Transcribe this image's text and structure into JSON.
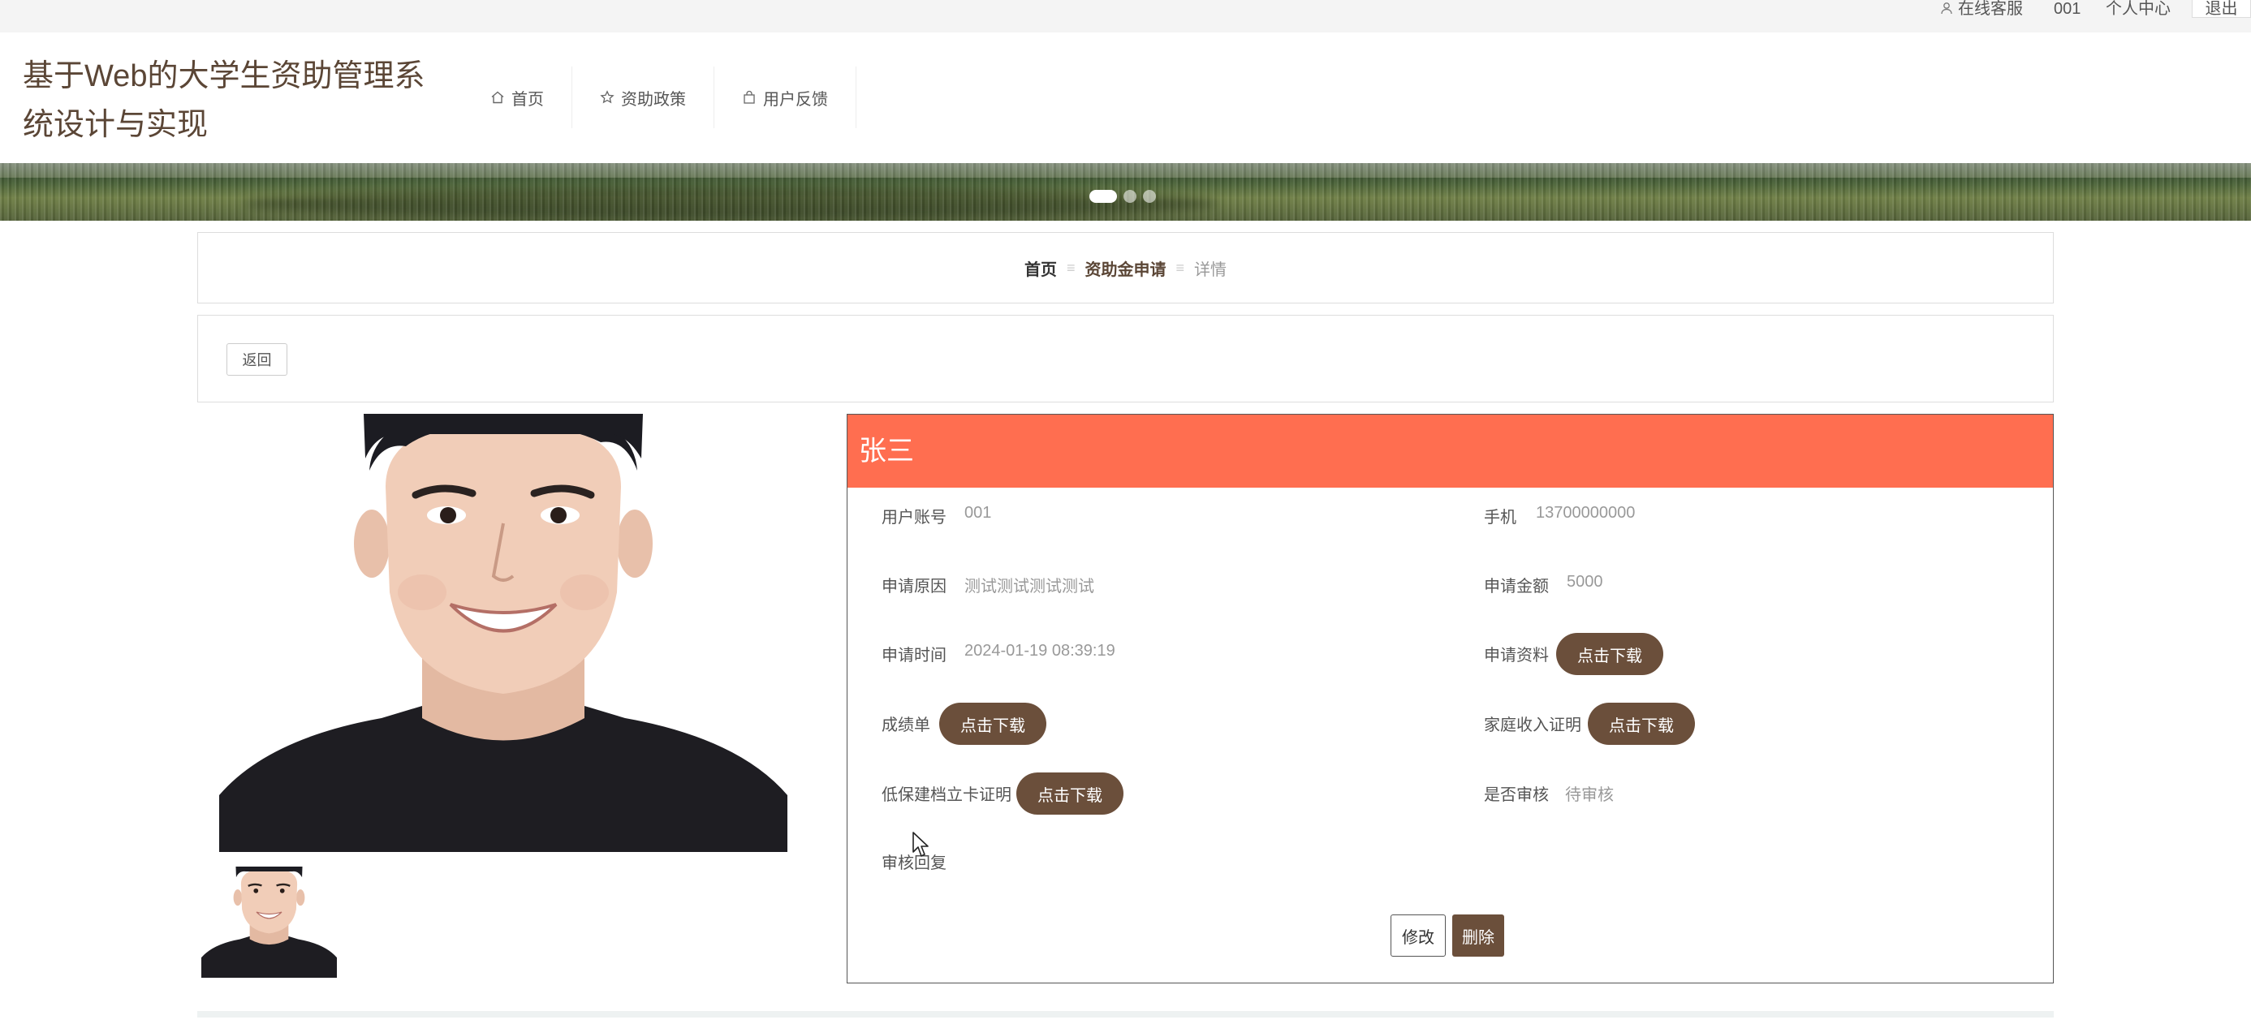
{
  "topbar": {
    "service": "在线客服",
    "user": "001",
    "center": "个人中心",
    "logout": "退出"
  },
  "header": {
    "site_title": "基于Web的大学生资助管理系统设计与实现",
    "nav": [
      {
        "label": "首页",
        "icon": "home-icon"
      },
      {
        "label": "资助政策",
        "icon": "star-icon"
      },
      {
        "label": "用户反馈",
        "icon": "bag-icon"
      }
    ]
  },
  "banner": {
    "slides_total": 3,
    "active_slide": 1
  },
  "breadcrumb": {
    "home": "首页",
    "section": "资助金申请",
    "current": "详情",
    "separator": "≡"
  },
  "actions": {
    "back": "返回"
  },
  "detail": {
    "name": "张三",
    "fields": {
      "account_label": "用户账号",
      "account_value": "001",
      "phone_label": "手机",
      "phone_value": "13700000000",
      "reason_label": "申请原因",
      "reason_value": "测试测试测试测试",
      "amount_label": "申请金额",
      "amount_value": "5000",
      "time_label": "申请时间",
      "time_value": "2024-01-19 08:39:19",
      "material_label": "申请资料",
      "transcript_label": "成绩单",
      "income_label": "家庭收入证明",
      "lowincome_label": "低保建档立卡证明",
      "review_label": "是否审核",
      "review_value": "待审核",
      "reply_label": "审核回复"
    },
    "download": "点击下载",
    "edit": "修改",
    "delete": "删除"
  },
  "colors": {
    "accent": "#6b4f3b",
    "header_bar": "#ff6e50",
    "title": "#5b4636"
  }
}
